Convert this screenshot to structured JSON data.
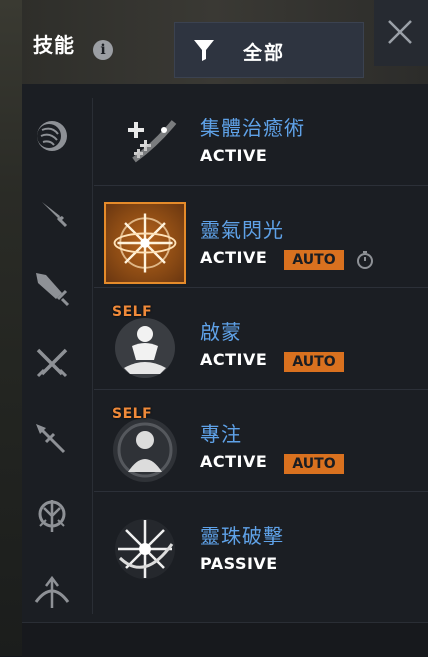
{
  "header": {
    "title": "技能",
    "filter_label": "全部"
  },
  "skills": [
    {
      "name": "集體治癒術",
      "type": "ACTIVE",
      "auto": "",
      "self": ""
    },
    {
      "name": "靈氣閃光",
      "type": "ACTIVE",
      "auto": "AUTO",
      "self": ""
    },
    {
      "name": "啟蒙",
      "type": "ACTIVE",
      "auto": "AUTO",
      "self": "SELF"
    },
    {
      "name": "專注",
      "type": "ACTIVE",
      "auto": "AUTO",
      "self": "SELF"
    },
    {
      "name": "靈珠破擊",
      "type": "PASSIVE",
      "auto": "",
      "self": ""
    }
  ],
  "colors": {
    "skill_name": "#5fa2e8",
    "auto_badge": "#d9711f",
    "self_badge": "#f08a3a",
    "selected_border": "#e58b2a"
  },
  "icons": {
    "sidebar": [
      "orb-icon",
      "sword-icon",
      "greatsword-icon",
      "dual-swords-icon",
      "spear-icon",
      "staff-icon",
      "bow-icon"
    ],
    "header": [
      "info-icon",
      "filter-icon",
      "close-icon"
    ]
  }
}
